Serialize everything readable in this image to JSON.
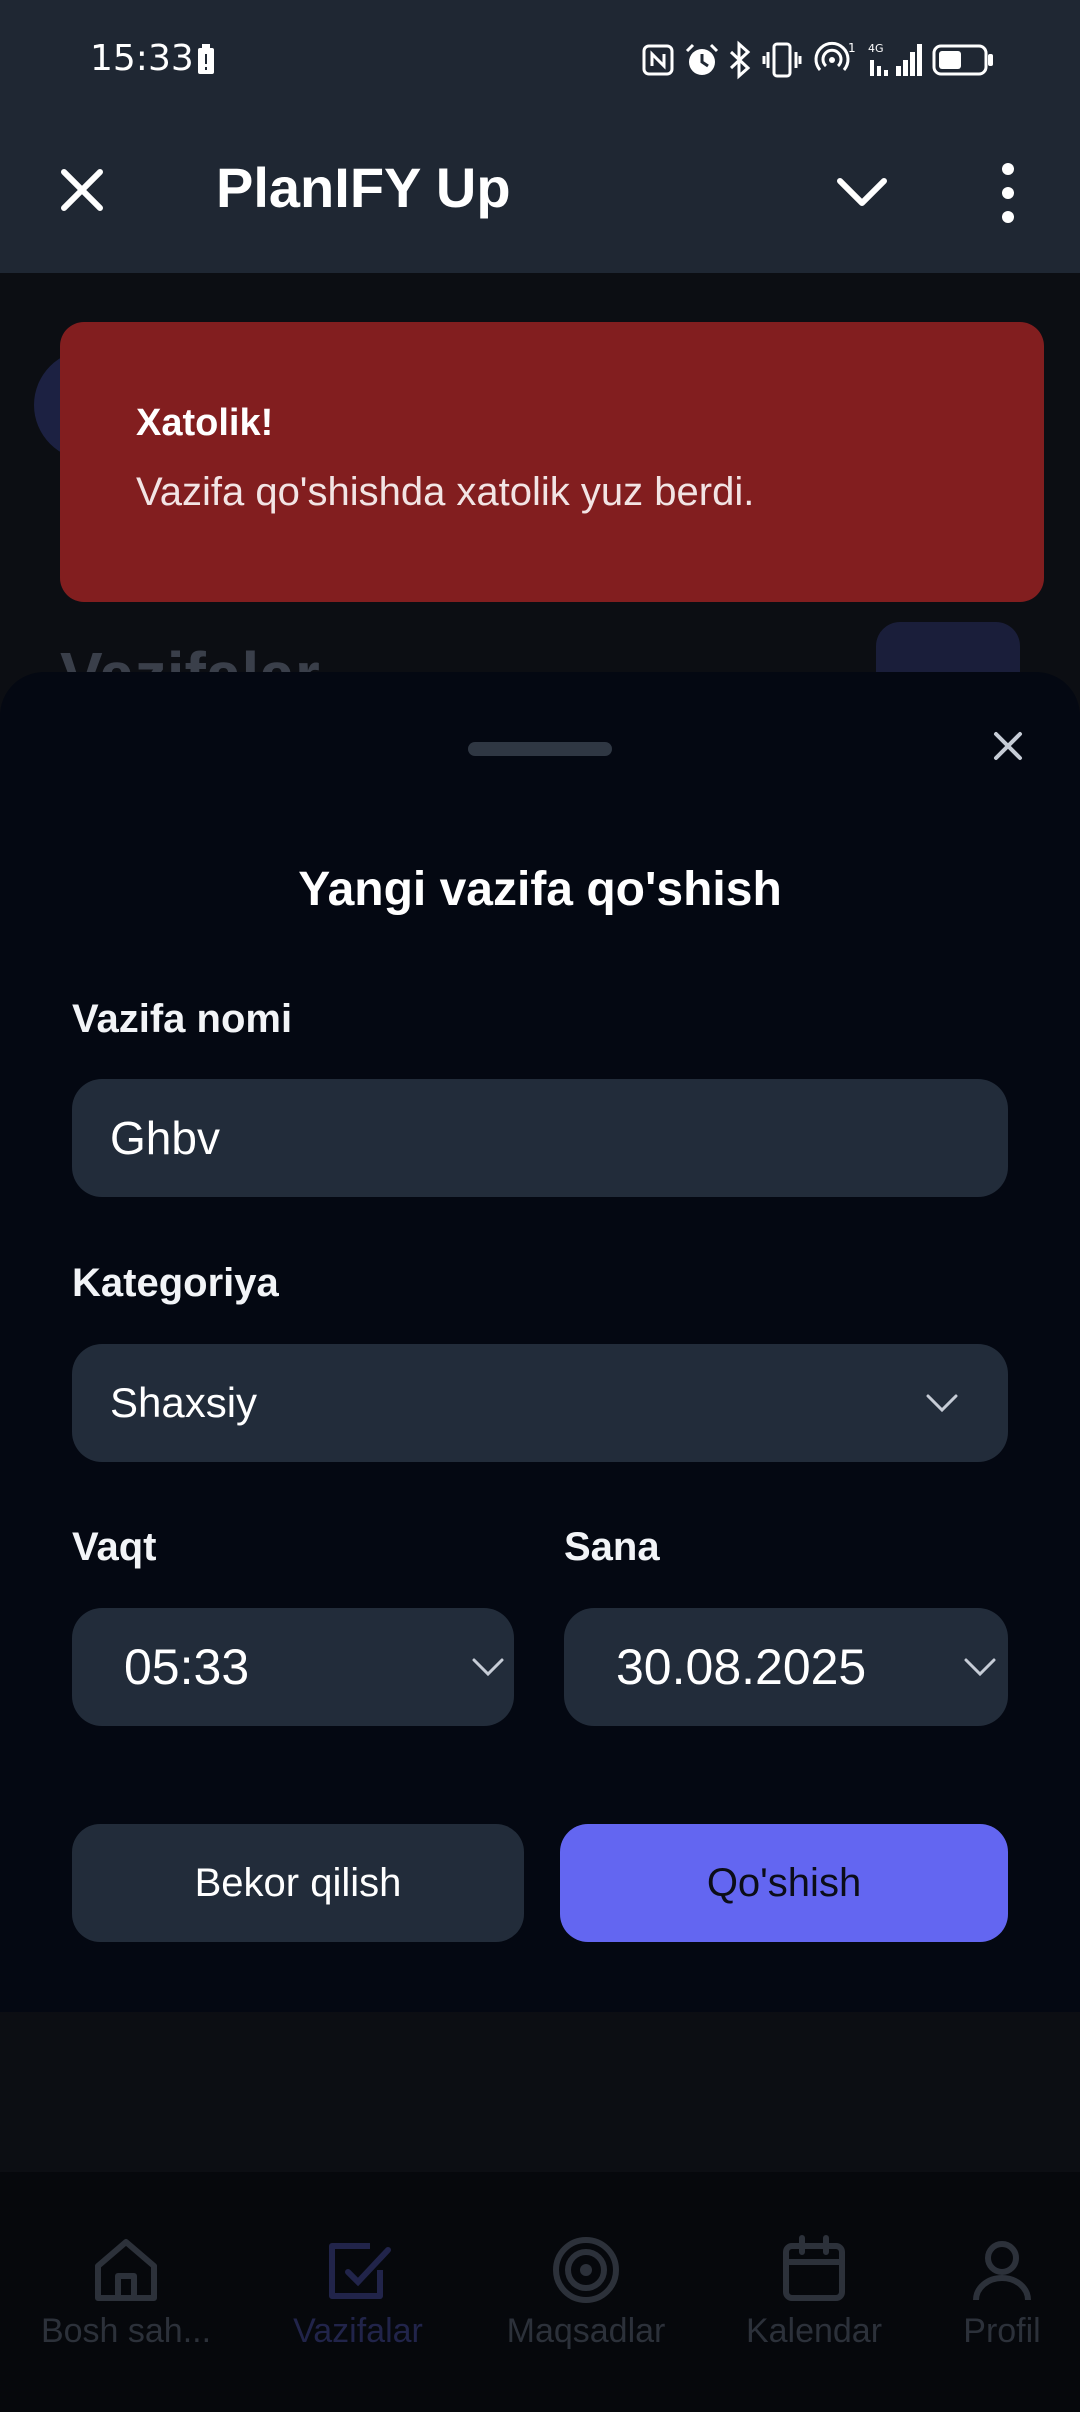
{
  "status_bar": {
    "time": "15:33",
    "icons": [
      "battery-saver-icon",
      "nfc-icon",
      "alarm-icon",
      "bluetooth-icon",
      "vibrate-icon",
      "hotspot-icon",
      "signal-icon",
      "battery-icon"
    ]
  },
  "app_bar": {
    "title": "PlanIFY Up"
  },
  "background": {
    "heading": "Vazifalar"
  },
  "toast": {
    "title": "Xatolik!",
    "message": "Vazifa qo'shishda xatolik yuz berdi.",
    "color": "#821e1f"
  },
  "sheet": {
    "title": "Yangi vazifa qo'shish",
    "name_label": "Vazifa nomi",
    "name_value": "Ghbv",
    "category_label": "Kategoriya",
    "category_value": "Shaxsiy",
    "time_label": "Vaqt",
    "time_value": "05:33",
    "date_label": "Sana",
    "date_value": "30.08.2025",
    "cancel_label": "Bekor qilish",
    "add_label": "Qo'shish",
    "accent": "#6366f1"
  },
  "bottom_nav": {
    "items": [
      {
        "label": "Bosh sah...",
        "icon": "home-icon"
      },
      {
        "label": "Vazifalar",
        "icon": "checkbox-icon",
        "active": true
      },
      {
        "label": "Maqsadlar",
        "icon": "target-icon"
      },
      {
        "label": "Kalendar",
        "icon": "calendar-icon"
      },
      {
        "label": "Profil",
        "icon": "user-icon"
      }
    ]
  }
}
